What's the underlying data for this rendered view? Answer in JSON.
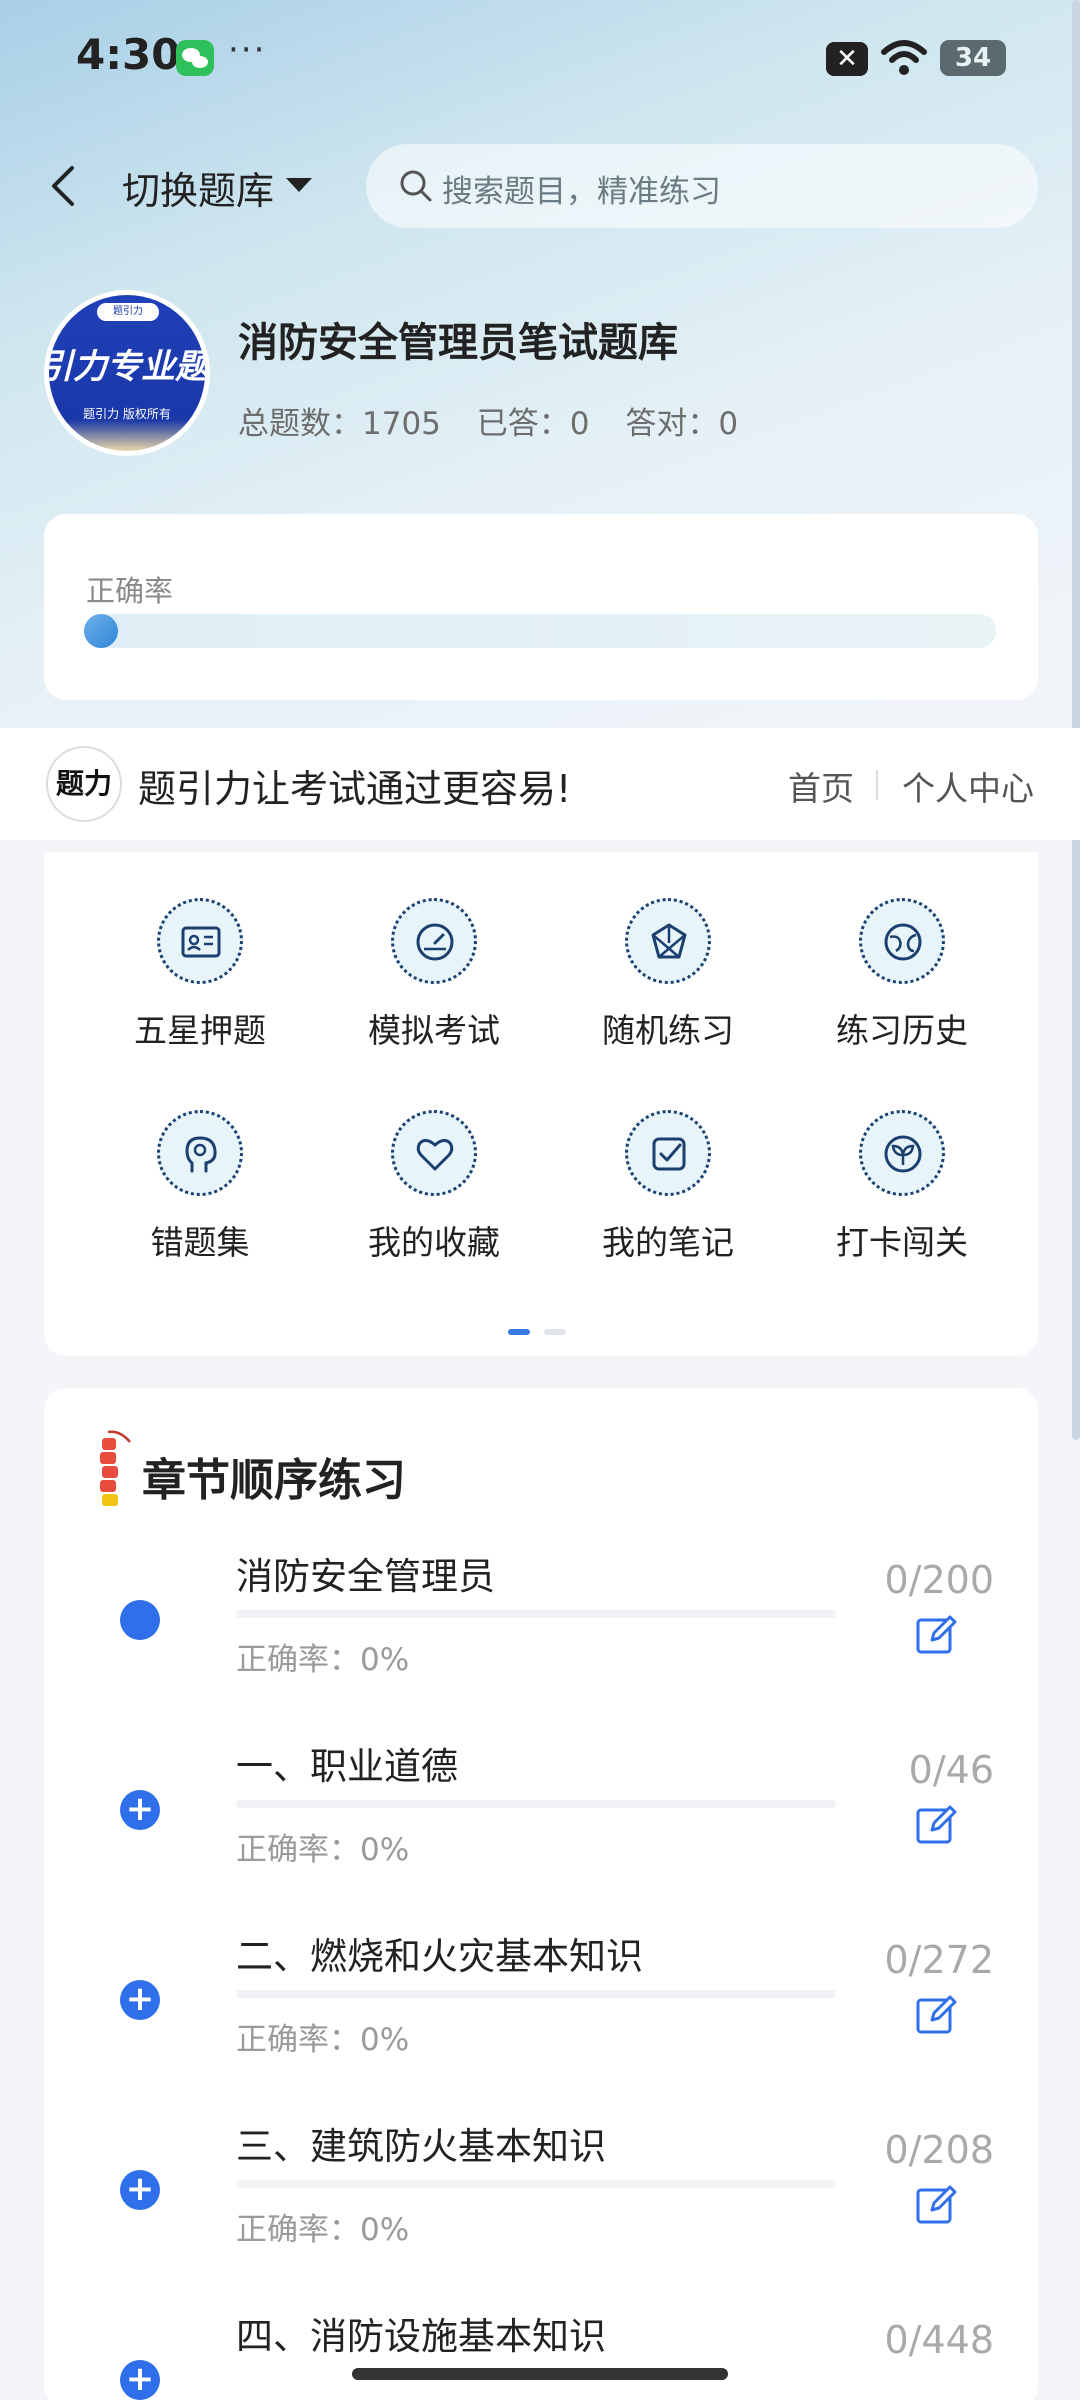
{
  "status": {
    "time": "4:30",
    "dots": "···",
    "close_badge": "✕",
    "battery": "34"
  },
  "header": {
    "switch_label": "切换题库",
    "search_placeholder": "搜索题目，精准练习"
  },
  "bank": {
    "logo_text": "引力专业题",
    "logo_tab": "题引力",
    "logo_sub": "题引力 版权所有",
    "title": "消防安全管理员笔试题库",
    "total": "总题数：1705",
    "answered": "已答：0",
    "correct": "答对：0"
  },
  "accuracy": {
    "label": "正确率",
    "value": 0
  },
  "brand": {
    "logo_glyph": "题力",
    "slogan": "题引力让考试通过更容易!",
    "home": "首页",
    "profile": "个人中心"
  },
  "menu": {
    "items": [
      {
        "label": "五星押题",
        "icon": "id-card-icon"
      },
      {
        "label": "模拟考试",
        "icon": "speedometer-icon"
      },
      {
        "label": "随机练习",
        "icon": "network-icon"
      },
      {
        "label": "练习历史",
        "icon": "globe-icon"
      },
      {
        "label": "错题集",
        "icon": "head-icon"
      },
      {
        "label": "我的收藏",
        "icon": "heart-icon"
      },
      {
        "label": "我的笔记",
        "icon": "check-note-icon"
      },
      {
        "label": "打卡闯关",
        "icon": "sprout-icon"
      }
    ],
    "page_current": 1,
    "page_total": 2
  },
  "chapters": {
    "title": "章节顺序练习",
    "rows": [
      {
        "name": "消防安全管理员",
        "rate": "正确率：0%",
        "count": "0/200",
        "marker": "dot"
      },
      {
        "name": "一、职业道德",
        "rate": "正确率：0%",
        "count": "0/46",
        "marker": "plus"
      },
      {
        "name": "二、燃烧和火灾基本知识",
        "rate": "正确率：0%",
        "count": "0/272",
        "marker": "plus"
      },
      {
        "name": "三、建筑防火基本知识",
        "rate": "正确率：0%",
        "count": "0/208",
        "marker": "plus"
      },
      {
        "name": "四、消防设施基本知识",
        "rate": "",
        "count": "0/448",
        "marker": "plus"
      }
    ]
  },
  "colors": {
    "accent": "#2f6fea",
    "icon_stroke": "#1b3f6e",
    "icon_fill": "#e7f4f9"
  }
}
